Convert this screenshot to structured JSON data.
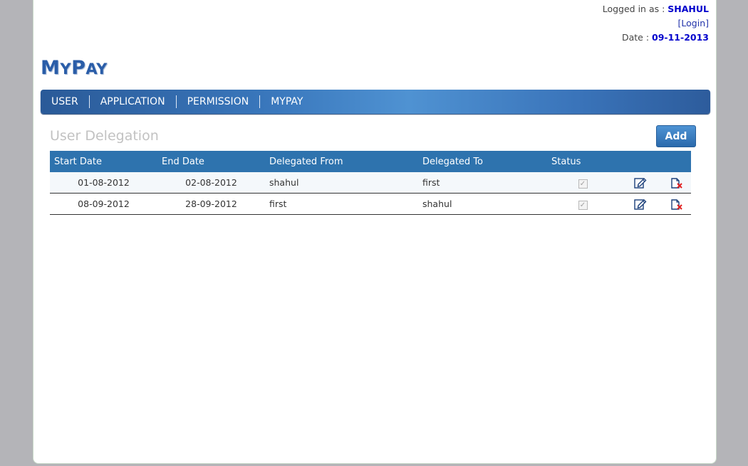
{
  "header": {
    "logged_in_prefix": "Logged in as : ",
    "username": "SHAHUL",
    "login_link": "[Login]",
    "date_prefix": "Date : ",
    "date": "09-11-2013"
  },
  "logo": {
    "big1": "M",
    "small1": "Y",
    "big2": "P",
    "small2": "AY"
  },
  "nav": {
    "items": [
      "USER",
      "APPLICATION",
      "PERMISSION",
      "MYPAY"
    ]
  },
  "page": {
    "title": "User Delegation",
    "add_label": "Add"
  },
  "table": {
    "columns": [
      "Start Date",
      "End Date",
      "Delegated From",
      "Delegated To",
      "Status"
    ],
    "rows": [
      {
        "start": "01-08-2012",
        "end": "02-08-2012",
        "from": "shahul",
        "to": "first",
        "status": true
      },
      {
        "start": "08-09-2012",
        "end": "28-09-2012",
        "from": "first",
        "to": "shahul",
        "status": true
      }
    ]
  },
  "colors": {
    "accent": "#2e73ae",
    "link": "#0000cc",
    "delete": "#e02020"
  },
  "icons": {
    "edit": "edit-icon",
    "delete": "delete-icon",
    "checkbox": "checkbox-checked"
  }
}
